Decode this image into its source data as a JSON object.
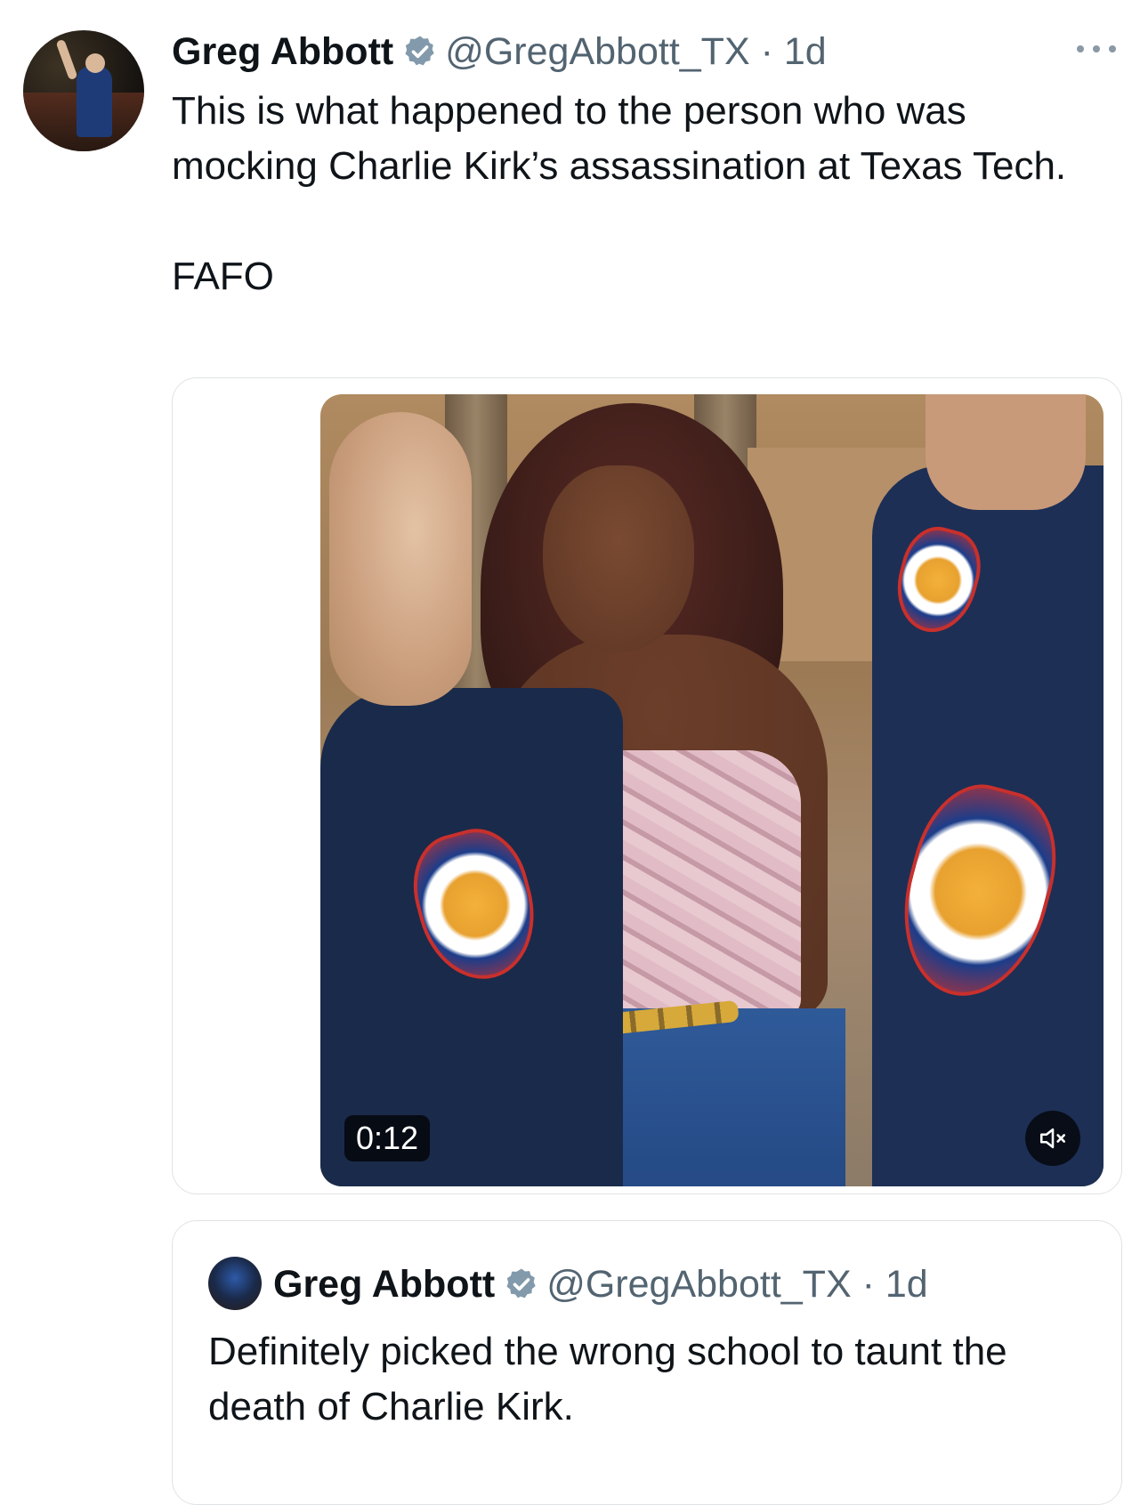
{
  "post": {
    "author_name": "Greg Abbott",
    "handle_time": "@GregAbbott_TX · 1d",
    "text": "This is what happened to the person who was mocking Charlie Kirk’s assassination at Texas Tech.\n\nFAFO",
    "avatar_icon": "profile-photo",
    "verified_icon": "verified-badge-icon",
    "verified_color": "#829aab",
    "more_icon": "more-options-icon"
  },
  "video": {
    "duration": "0:12",
    "mute_icon": "speaker-muted-icon"
  },
  "quoted_post": {
    "author_name": "Greg Abbott",
    "handle_time": "@GregAbbott_TX · 1d",
    "text": "Definitely picked the wrong school to taunt the death of Charlie Kirk."
  },
  "colors": {
    "text_primary": "#0f1419",
    "text_secondary": "#536471",
    "border": "#dfe3e6"
  }
}
